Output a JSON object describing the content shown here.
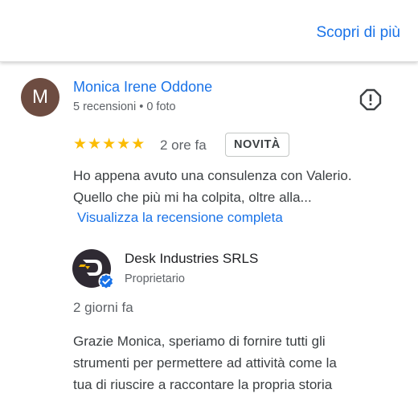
{
  "header": {
    "more_link": "Scopri di più"
  },
  "review": {
    "avatar_letter": "M",
    "author_name": "Monica Irene Oddone",
    "author_meta": "5 recensioni • 0 foto",
    "rating": 5,
    "stars": [
      "★",
      "★",
      "★",
      "★",
      "★"
    ],
    "time_ago": "2 ore fa",
    "badge": "NOVITÀ",
    "text_line1": "Ho appena avuto una consulenza con Valerio.",
    "text_line2": "Quello che più mi ha colpita, oltre alla...",
    "full_review_link": "Visualizza la recensione completa"
  },
  "owner_reply": {
    "name": "Desk Industries SRLS",
    "role": "Proprietario",
    "time_ago": "2 giorni fa",
    "text_line1": "Grazie Monica, speriamo di fornire tutti gli",
    "text_line2": "strumenti per permettere ad attività come la",
    "text_line3": "tua di riuscire a raccontare la propria storia"
  },
  "icons": {
    "flag": "report-flag-icon",
    "verified": "verified-badge-icon",
    "owner_logo": "desk-industries-logo"
  },
  "colors": {
    "link": "#1a73e8",
    "star": "#fbbc04",
    "avatar": "#6d4c41",
    "verified": "#1a73e8"
  }
}
